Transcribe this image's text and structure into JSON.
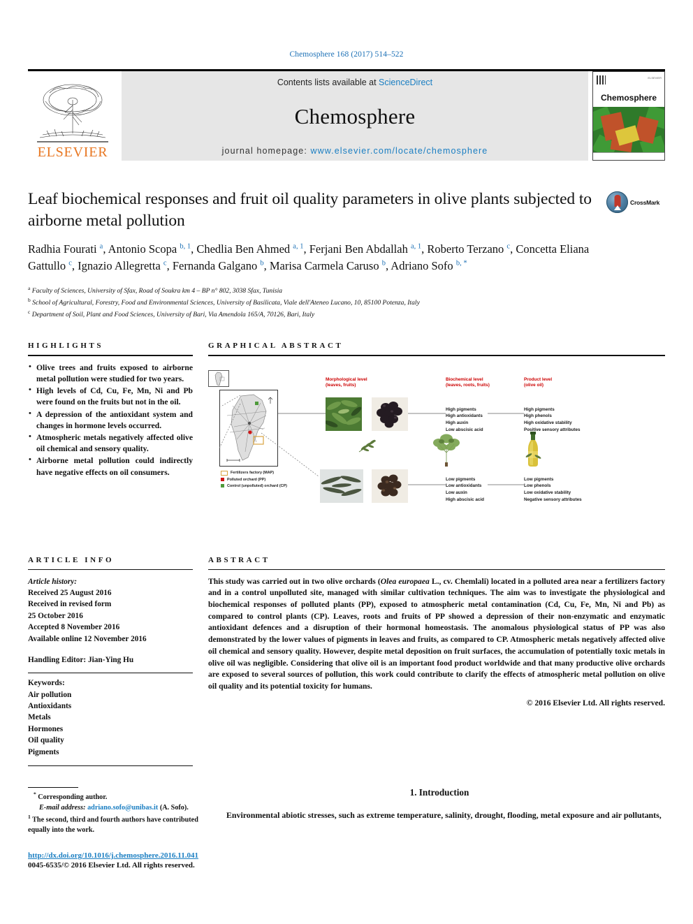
{
  "running_head": "Chemosphere 168 (2017) 514–522",
  "masthead": {
    "contents_prefix": "Contents lists available at ",
    "sciencedirect": "ScienceDirect",
    "journal_title": "Chemosphere",
    "homepage_prefix": "journal homepage: ",
    "homepage_url": "www.elsevier.com/locate/chemosphere",
    "publisher": "ELSEVIER",
    "cover_title": "Chemosphere",
    "link_color": "#1a7ec2",
    "band_color": "#e6e6e6",
    "publisher_color": "#E87722"
  },
  "article": {
    "title": "Leaf biochemical responses and fruit oil quality parameters in olive plants subjected to airborne metal pollution",
    "crossmark_label": "CrossMark",
    "authors_html": "Radhia Fourati <sup>a</sup>, Antonio Scopa <sup>b, 1</sup>, Chedlia Ben Ahmed <sup>a, 1</sup>, Ferjani Ben Abdallah <sup>a, 1</sup>, Roberto Terzano <sup>c</sup>, Concetta Eliana Gattullo <sup>c</sup>, Ignazio Allegretta <sup>c</sup>, Fernanda Galgano <sup>b</sup>, Marisa Carmela Caruso <sup>b</sup>, Adriano Sofo <sup>b, *</sup>",
    "affiliations": [
      {
        "marker": "a",
        "text": "Faculty of Sciences, University of Sfax, Road of Soukra km 4 – BP n° 802, 3038 Sfax, Tunisia"
      },
      {
        "marker": "b",
        "text": "School of Agricultural, Forestry, Food and Environmental Sciences, University of Basilicata, Viale dell'Ateneo Lucano, 10, 85100 Potenza, Italy"
      },
      {
        "marker": "c",
        "text": "Department of Soil, Plant and Food Sciences, University of Bari, Via Amendola 165/A, 70126, Bari, Italy"
      }
    ]
  },
  "highlights": {
    "heading": "HIGHLIGHTS",
    "items": [
      "Olive trees and fruits exposed to airborne metal pollution were studied for two years.",
      "High levels of Cd, Cu, Fe, Mn, Ni and Pb were found on the fruits but not in the oil.",
      "A depression of the antioxidant system and changes in hormone levels occurred.",
      "Atmospheric metals negatively affected olive oil chemical and sensory quality.",
      "Airborne metal pollution could indirectly have negative effects on oil consumers."
    ]
  },
  "article_info": {
    "heading": "ARTICLE INFO",
    "history_label": "Article history:",
    "history": [
      "Received 25 August 2016",
      "Received in revised form",
      "25 October 2016",
      "Accepted 8 November 2016",
      "Available online 12 November 2016"
    ],
    "handling_editor": "Handling Editor: Jian-Ying Hu",
    "keywords_label": "Keywords:",
    "keywords": [
      "Air pollution",
      "Antioxidants",
      "Metals",
      "Hormones",
      "Oil quality",
      "Pigments"
    ]
  },
  "graphical_abstract": {
    "heading": "GRAPHICAL ABSTRACT",
    "columns": [
      {
        "title_line1": "Morphological level",
        "title_line2": "(leaves, fruits)"
      },
      {
        "title_line1": "Biochemical level",
        "title_line2": "(leaves, roots, fruits)"
      },
      {
        "title_line1": "Product level",
        "title_line2": "(olive oil)"
      }
    ],
    "biochemical_top": [
      "High pigments",
      "High antioxidants",
      "High auxin",
      "Low abscisic acid"
    ],
    "biochemical_bottom": [
      "Low pigments",
      "Low antioxidants",
      "Low auxin",
      "High abscisic acid"
    ],
    "product_top": [
      "High pigments",
      "High phenols",
      "High oxidative stability",
      "Positive sensory attributes"
    ],
    "product_bottom": [
      "Low pigments",
      "Low phenols",
      "Low oxidative stability",
      "Negative sensory attributes"
    ],
    "legend": [
      {
        "label": "Fertilizers factory (MAP)",
        "swatch": "box-yellow"
      },
      {
        "label": "Polluted orchard (PP)",
        "swatch": "red"
      },
      {
        "label": "Control (unpolluted) orchard (CP)",
        "swatch": "green"
      }
    ],
    "title_color": "#cc0000"
  },
  "abstract": {
    "heading": "ABSTRACT",
    "p1_a": "This study was carried out in two olive orchards (",
    "p1_italic": "Olea europaea",
    "p1_b": " L., cv. Chemlali) located in a polluted area near a fertilizers factory and in a control unpolluted site, managed with similar cultivation techniques. The aim was to investigate the physiological and biochemical responses of polluted plants (PP), exposed to atmospheric metal contamination (Cd, Cu, Fe, Mn, Ni and Pb) as compared to control plants (CP). Leaves, roots and fruits of PP showed a depression of their non-enzymatic and enzymatic antioxidant defences and a disruption of their hormonal homeostasis. The anomalous physiological status of PP was also demonstrated by the lower values of pigments in leaves and fruits, as compared to CP. Atmospheric metals negatively affected olive oil chemical and sensory quality. However, despite metal deposition on fruit surfaces, the accumulation of potentially toxic metals in olive oil was negligible. Considering that olive oil is an important food product worldwide and that many productive olive orchards are exposed to several sources of pollution, this work could contribute to clarify the effects of atmospheric metal pollution on olive oil quality and its potential toxicity for humans.",
    "copyright": "© 2016 Elsevier Ltd. All rights reserved."
  },
  "footnotes": {
    "corresponding_marker": "*",
    "corresponding": "Corresponding author.",
    "email_label": "E-mail address:",
    "email": "adriano.sofo@unibas.it",
    "email_suffix": "(A. Sofo).",
    "note_marker": "1",
    "note": "The second, third and fourth authors have contributed equally into the work."
  },
  "publication_footer": {
    "doi": "http://dx.doi.org/10.1016/j.chemosphere.2016.11.041",
    "issn_line": "0045-6535/© 2016 Elsevier Ltd. All rights reserved."
  },
  "introduction": {
    "heading": "1. Introduction",
    "paragraph": "Environmental abiotic stresses, such as extreme temperature, salinity, drought, flooding, metal exposure and air pollutants,"
  }
}
